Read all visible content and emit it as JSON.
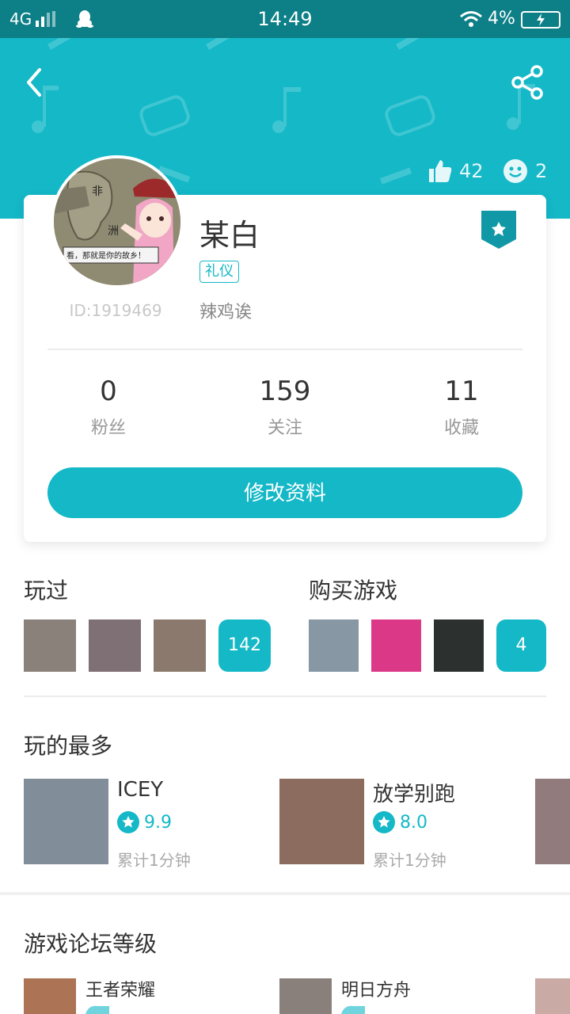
{
  "status_bar": {
    "network": "4G",
    "time": "14:49",
    "battery": "4%"
  },
  "header": {
    "likes": "42",
    "smiles": "2"
  },
  "profile": {
    "name": "某白",
    "tag": "礼仪",
    "nickname": "辣鸡诶",
    "id": "ID:1919469",
    "avatar_text": [
      "非",
      "洲",
      "看，那就是你的故乡！"
    ]
  },
  "stats": [
    {
      "value": "0",
      "label": "粉丝"
    },
    {
      "value": "159",
      "label": "关注"
    },
    {
      "value": "11",
      "label": "收藏"
    }
  ],
  "edit_button": "修改资料",
  "played": {
    "title": "玩过",
    "count": "142",
    "colors": [
      "#8b817b",
      "#7f7076",
      "#8b796d"
    ]
  },
  "purchased": {
    "title": "购买游戏",
    "count": "4",
    "colors": [
      "#8797a3",
      "#db3987",
      "#2c3130"
    ]
  },
  "most_played": {
    "title": "玩的最多",
    "games": [
      {
        "name": "ICEY",
        "score": "9.9",
        "time": "累计1分钟",
        "color": "#818e99"
      },
      {
        "name": "放学别跑",
        "score": "8.0",
        "time": "累计1分钟",
        "color": "#8b6c5e"
      },
      {
        "name": "",
        "score": "",
        "time": "",
        "color": "#917b7c"
      }
    ]
  },
  "forum": {
    "title": "游戏论坛等级",
    "items": [
      {
        "name": "王者荣耀",
        "color": "#ac7454"
      },
      {
        "name": "明日方舟",
        "color": "#8a807b"
      },
      {
        "name": "",
        "color": "#c9aaa4"
      }
    ]
  },
  "colors": {
    "accent": "#14b8c7",
    "status_bar": "#0d7f87"
  }
}
